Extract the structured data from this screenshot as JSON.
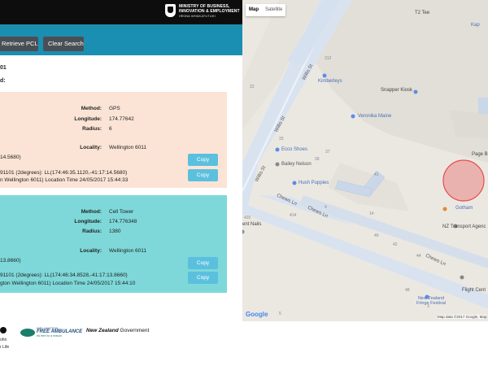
{
  "header": {
    "ministry_line1": "MINISTRY OF BUSINESS,",
    "ministry_line2": "INNOVATION & EMPLOYMENT",
    "ministry_line3": "HĪKINA WHAKATUTUKI"
  },
  "toolbar": {
    "retrieve_label": "Retrieve PCL",
    "clear_label": "Clear Search"
  },
  "content": {
    "heading_fragment": "01",
    "subheading_fragment": "d:"
  },
  "cards": [
    {
      "method_label": "Method:",
      "method": "GPS",
      "longitude_label": "Longitude:",
      "longitude": "174.77642",
      "radius_label": "Radius:",
      "radius": "6",
      "locality_label": "Locality:",
      "locality": "Wellington 6011",
      "coord_fragment": "14.5680)",
      "line1": "91101 (2degrees): LL(174:46:35.1120,-41:17:14.5680)",
      "line2": "n Wellington 6011) Location Time 24/05/2017 15:44:33",
      "copy1": "Copy",
      "copy2": "Copy"
    },
    {
      "method_label": "Method:",
      "method": "Cell Tower",
      "longitude_label": "Longitude:",
      "longitude": "174.776348",
      "radius_label": "Radius:",
      "radius": "1380",
      "locality_label": "Locality:",
      "locality": "Wellington 6011",
      "coord_fragment": "13.8660)",
      "line1": "91101 (2degrees): LL(174:46:34.8528,-41:17:13.8660)",
      "line2": "gton Wellington 6011) Location Time 24/05/2017 15:44:10",
      "copy1": "Copy",
      "copy2": "Copy"
    }
  ],
  "footer": {
    "ohn_fragment": "ohn",
    "life_fragment": "r Life",
    "wfa_small": "WELLINGTON",
    "wfa_big": "FREE AMBULANCE",
    "wfa_tagline": "it's free for a reason",
    "nz_gov_prefix": "New Zealand",
    "nz_gov_suffix": "Government"
  },
  "map": {
    "type_map": "Map",
    "type_satellite": "Satellite",
    "google_label": "Google",
    "map_data": "Map data ©2017 Google, Map",
    "streets": {
      "willis1": "Willis St",
      "willis2": "Willis St",
      "willis3": "Willis St",
      "chews1": "Chews Ln",
      "chews2": "Chews Ln",
      "chews3": "Chews Ln"
    },
    "places": {
      "kimberleys": "Kimberleys",
      "snapper": "Snapper Kiosk",
      "veronika": "Veronika Maine",
      "ecco": "Ecco Shoes",
      "bailey": "Bailey Nelson",
      "hush": "Hush Puppies",
      "page": "Page B",
      "gotham": "Gotham",
      "nzta": "NZ Transport Agenc",
      "flight": "Flight Cent",
      "festival1": "New Zealand",
      "festival2": "Fringe Festival",
      "nails": "ent Nails",
      "t2tee": "T2 Tee",
      "kap": "Kap",
      "num312": "312",
      "num33": "33",
      "num37": "37",
      "num39": "39",
      "num41": "41",
      "num4a": "4",
      "num414": "414",
      "num14": "14",
      "num40": "40",
      "num42": "42",
      "num44": "44",
      "num22": "22",
      "num48": "48",
      "num5": "5",
      "num420": "420",
      "num3": "3"
    },
    "circle_color": "#e84c4c"
  }
}
